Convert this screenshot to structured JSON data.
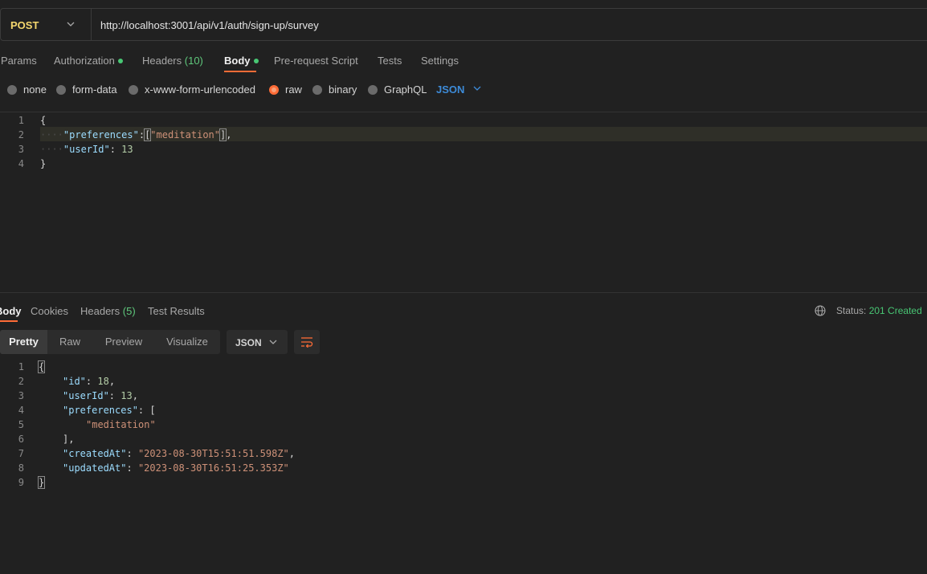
{
  "request": {
    "method": "POST",
    "url": "http://localhost:3001/api/v1/auth/sign-up/survey"
  },
  "request_tabs": [
    {
      "label": "Params"
    },
    {
      "label": "Authorization"
    },
    {
      "label": "Headers",
      "count": "(10)"
    },
    {
      "label": "Body"
    },
    {
      "label": "Pre-request Script"
    },
    {
      "label": "Tests"
    },
    {
      "label": "Settings"
    }
  ],
  "body_types": [
    "none",
    "form-data",
    "x-www-form-urlencoded",
    "raw",
    "binary",
    "GraphQL"
  ],
  "body_format": "JSON",
  "request_body": {
    "line_numbers": [
      "1",
      "2",
      "3",
      "4"
    ],
    "open": "{",
    "key1": "\"preferences\"",
    "colon1": ":",
    "lb": "[",
    "val1": "\"meditation\"",
    "rb": "]",
    "comma1": ",",
    "key2": "\"userId\"",
    "colon2": ": ",
    "val2": "13",
    "close": "}",
    "indent": "····"
  },
  "response_tabs": [
    {
      "label": "Body"
    },
    {
      "label": "Cookies"
    },
    {
      "label": "Headers",
      "count": "(5)"
    },
    {
      "label": "Test Results"
    }
  ],
  "status": {
    "label": "Status:",
    "value": "201 Created"
  },
  "view_modes": [
    "Pretty",
    "Raw",
    "Preview",
    "Visualize"
  ],
  "response_format": "JSON",
  "response_body": {
    "line_numbers": [
      "1",
      "2",
      "3",
      "4",
      "5",
      "6",
      "7",
      "8",
      "9"
    ],
    "open": "{",
    "id_key": "\"id\"",
    "id_val": "18",
    "uid_key": "\"userId\"",
    "uid_val": "13",
    "pref_key": "\"preferences\"",
    "pref_open": "[",
    "pref_item": "\"meditation\"",
    "pref_close": "],",
    "created_key": "\"createdAt\"",
    "created_val": "\"2023-08-30T15:51:51.598Z\"",
    "updated_key": "\"updatedAt\"",
    "updated_val": "\"2023-08-30T16:51:25.353Z\"",
    "close": "}",
    "colon": ": ",
    "comma": ","
  },
  "colors": {
    "accent": "#ff6c37",
    "method": "#f5d76e",
    "status_ok": "#48c774",
    "json_select": "#3d8bd8"
  }
}
